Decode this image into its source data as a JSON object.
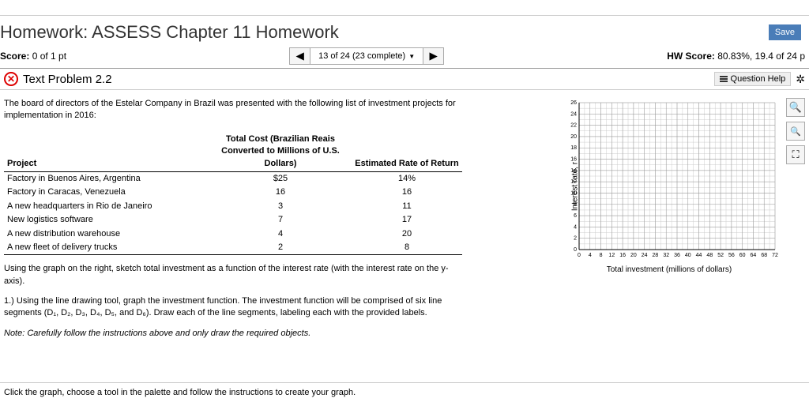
{
  "topbar": {
    "left": "",
    "right": ""
  },
  "header": {
    "title": "Homework: ASSESS Chapter 11 Homework",
    "save": "Save"
  },
  "scorebar": {
    "score_label": "Score:",
    "score_value": "0 of 1 pt",
    "nav_text": "13 of 24 (23 complete)",
    "hw_label": "HW Score:",
    "hw_value": "80.83%, 19.4 of 24 p"
  },
  "problem": {
    "title": "Text Problem 2.2",
    "qhelp": "Question Help"
  },
  "body": {
    "intro": "The board of directors of the Estelar Company in Brazil was presented with the following list of investment projects for implementation in 2016:",
    "table_head": {
      "project": "Project",
      "cost": "Total Cost (Brazilian Reais Converted to Millions of U.S. Dollars)",
      "ror": "Estimated Rate of Return"
    },
    "rows": [
      {
        "project": "Factory in Buenos Aires, Argentina",
        "cost": "$25",
        "ror": "14%"
      },
      {
        "project": "Factory in Caracas, Venezuela",
        "cost": "16",
        "ror": "16"
      },
      {
        "project": "A new headquarters in Rio de Janeiro",
        "cost": "3",
        "ror": "11"
      },
      {
        "project": "New logistics software",
        "cost": "7",
        "ror": "17"
      },
      {
        "project": "A new distribution warehouse",
        "cost": "4",
        "ror": "20"
      },
      {
        "project": "A new fleet of delivery trucks",
        "cost": "2",
        "ror": "8"
      }
    ],
    "instr1": "Using the graph on the right, sketch total investment as a function of the interest rate (with the interest rate on the y-axis).",
    "instr2": "1.) Using the line drawing tool, graph the investment function. The investment function will be comprised of six line segments (D₁, D₂, D₃, D₄, D₅, and D₆). Draw each of the line segments, labeling each with the provided labels.",
    "note": "Note: Carefully follow the instructions above and only draw the required objects."
  },
  "chart_data": {
    "type": "scatter",
    "xlabel": "Total investment (millions of dollars)",
    "ylabel": "Interest rate, r",
    "xlim": [
      0,
      72
    ],
    "ylim": [
      0,
      26
    ],
    "xticks": [
      0,
      4,
      8,
      12,
      16,
      20,
      24,
      28,
      32,
      36,
      40,
      44,
      48,
      52,
      56,
      60,
      64,
      68,
      72
    ],
    "yticks": [
      0,
      2,
      4,
      6,
      8,
      10,
      12,
      14,
      16,
      18,
      20,
      22,
      24,
      26
    ],
    "series": []
  },
  "footer": "Click the graph, choose a tool in the palette and follow the instructions to create your graph."
}
